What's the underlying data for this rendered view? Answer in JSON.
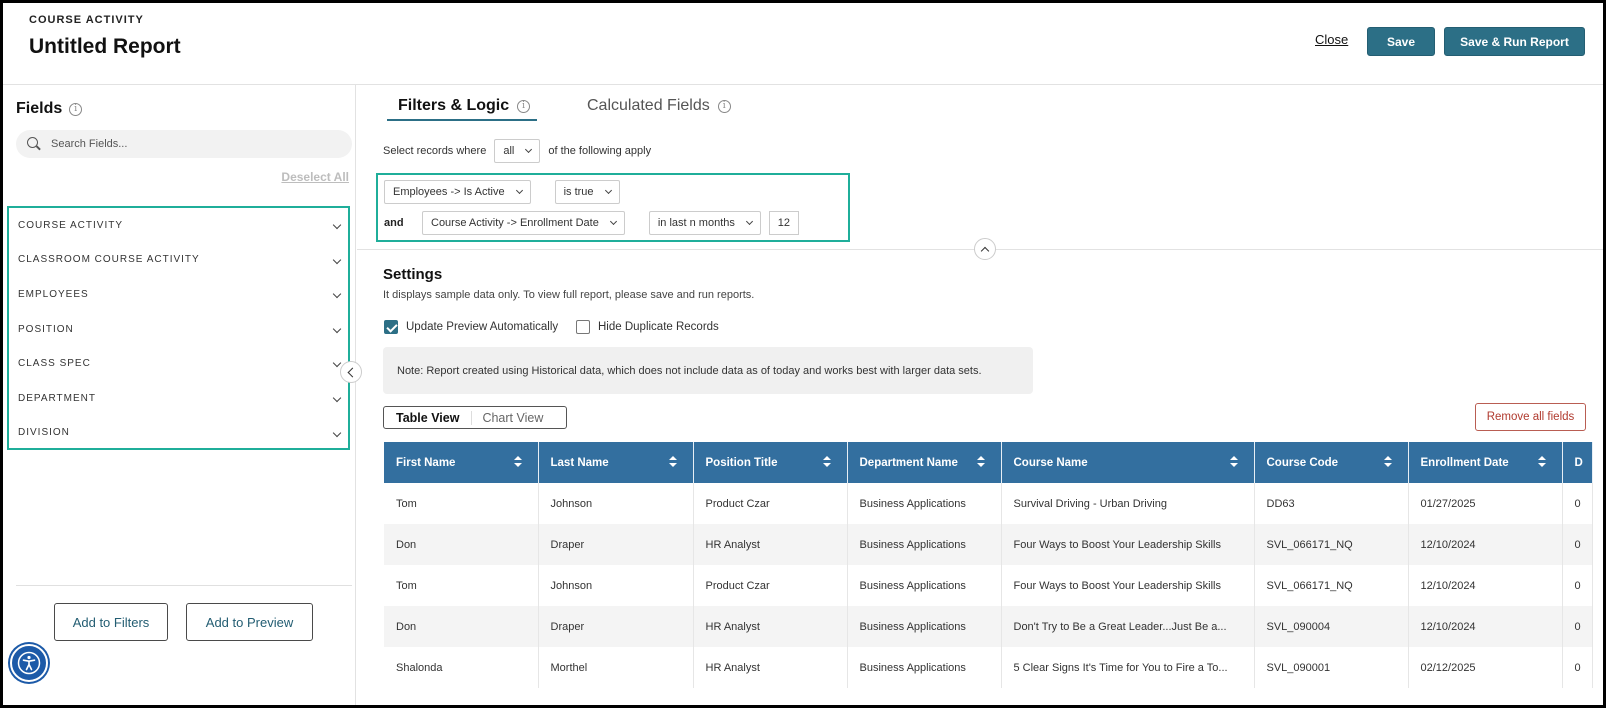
{
  "header": {
    "eyebrow": "COURSE ACTIVITY",
    "title": "Untitled Report",
    "close_label": "Close",
    "save_label": "Save",
    "save_run_label": "Save & Run Report"
  },
  "left_panel": {
    "title": "Fields",
    "search_placeholder": "Search Fields...",
    "deselect_all": "Deselect All",
    "groups": [
      "COURSE ACTIVITY",
      "CLASSROOM COURSE ACTIVITY",
      "EMPLOYEES",
      "POSITION",
      "CLASS SPEC",
      "DEPARTMENT",
      "DIVISION"
    ],
    "add_filters_label": "Add to Filters",
    "add_preview_label": "Add to Preview"
  },
  "tabs": {
    "filters": "Filters & Logic",
    "calculated": "Calculated Fields"
  },
  "filters": {
    "select_records_prefix": "Select records where",
    "match_mode": "all",
    "select_records_suffix": "of the following apply",
    "row1": {
      "field": "Employees -> Is Active",
      "operator": "is true"
    },
    "row2": {
      "conjunction": "and",
      "field": "Course Activity -> Enrollment Date",
      "operator": "in last n months",
      "value": "12"
    }
  },
  "settings": {
    "title": "Settings",
    "description": "It displays sample data only. To view full report, please save and run reports.",
    "update_preview_label": "Update Preview Automatically",
    "update_preview_checked": true,
    "hide_duplicates_label": "Hide Duplicate Records",
    "hide_duplicates_checked": false,
    "note": "Note: Report created using Historical data, which does not include data as of today and works best with larger data sets.",
    "table_view_label": "Table View",
    "chart_view_label": "Chart View",
    "remove_all_label": "Remove all fields"
  },
  "table": {
    "columns": [
      "First Name",
      "Last Name",
      "Position Title",
      "Department Name",
      "Course Name",
      "Course Code",
      "Enrollment Date",
      "D"
    ],
    "rows": [
      [
        "Tom",
        "Johnson",
        "Product Czar",
        "Business Applications",
        "Survival Driving - Urban Driving",
        "DD63",
        "01/27/2025",
        "0"
      ],
      [
        "Don",
        "Draper",
        "HR Analyst",
        "Business Applications",
        "Four Ways to Boost Your Leadership Skills",
        "SVL_066171_NQ",
        "12/10/2024",
        "0"
      ],
      [
        "Tom",
        "Johnson",
        "Product Czar",
        "Business Applications",
        "Four Ways to Boost Your Leadership Skills",
        "SVL_066171_NQ",
        "12/10/2024",
        "0"
      ],
      [
        "Don",
        "Draper",
        "HR Analyst",
        "Business Applications",
        "Don't Try to Be a Great Leader...Just Be a...",
        "SVL_090004",
        "12/10/2024",
        "0"
      ],
      [
        "Shalonda",
        "Morthel",
        "HR Analyst",
        "Business Applications",
        "5 Clear Signs It's Time for You to Fire a To...",
        "SVL_090001",
        "02/12/2025",
        "0"
      ]
    ]
  },
  "colors": {
    "accent": "#2c6f86",
    "table_header": "#336f9f",
    "highlight": "#1fae9a"
  }
}
